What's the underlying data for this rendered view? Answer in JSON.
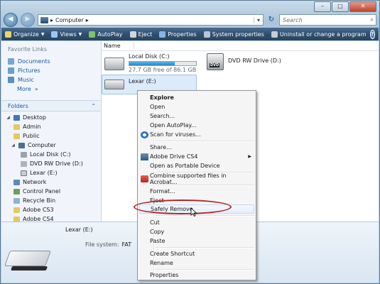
{
  "address": {
    "crumb": "Computer",
    "search_placeholder": "Search"
  },
  "toolbar": {
    "organize": "Organize",
    "views": "Views",
    "autoplay": "AutoPlay",
    "eject": "Eject",
    "properties": "Properties",
    "system_properties": "System properties",
    "uninstall": "Uninstall or change a program"
  },
  "favorites": {
    "header": "Favorite Links",
    "items": [
      "Documents",
      "Pictures",
      "Music"
    ],
    "more": "More"
  },
  "folders": {
    "header": "Folders",
    "tree": [
      "Desktop",
      "Admin",
      "Public",
      "Computer",
      "Local Disk (C:)",
      "DVD RW Drive (D:)",
      "Lexar (E:)",
      "Network",
      "Control Panel",
      "Recycle Bin",
      "Adobe CS3",
      "Adobe CS4"
    ]
  },
  "main": {
    "column_name": "Name",
    "drives": {
      "c_name": "Local Disk (C:)",
      "c_free": "27.7 GB free of 86.1 GB",
      "c_used_fraction": 0.68,
      "d_name": "DVD RW Drive (D:)",
      "dvd_badge": "DVD",
      "e_name": "Lexar (E:)"
    }
  },
  "details": {
    "name": "Lexar (E:)",
    "fs_label": "File system:",
    "fs_value": "FAT"
  },
  "context_menu": {
    "items": [
      "Explore",
      "Open",
      "Search...",
      "Open AutoPlay...",
      "Scan for viruses...",
      "Share...",
      "Adobe Drive CS4",
      "Open as Portable Device",
      "Combine supported files in Acrobat...",
      "Format...",
      "Eject",
      "Safely Remove",
      "Cut",
      "Copy",
      "Paste",
      "Create Shortcut",
      "Rename",
      "Properties"
    ]
  },
  "colors": {
    "accent": "#1a5aa5",
    "highlight_ring": "#b5232a",
    "progress": "#2b86c4"
  }
}
